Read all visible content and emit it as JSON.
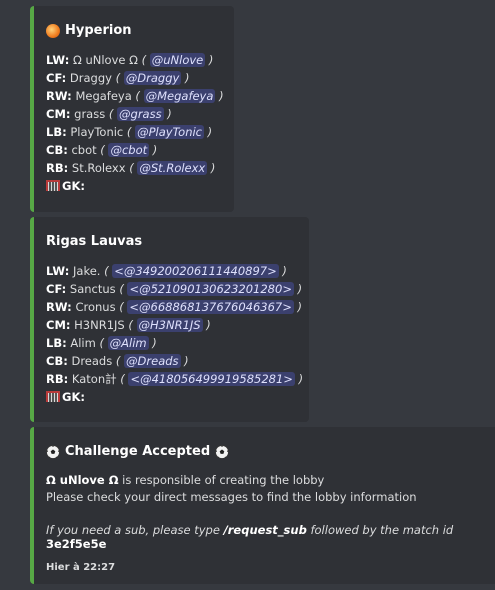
{
  "embed1": {
    "title": "Hyperion",
    "rows": [
      {
        "pos": "LW:",
        "name": "Ω uNlove Ω",
        "mention": "@uNlove"
      },
      {
        "pos": "CF:",
        "name": "Draggy",
        "mention": "@Draggy"
      },
      {
        "pos": "RW:",
        "name": "Megafeya",
        "mention": "@Megafeya"
      },
      {
        "pos": "CM:",
        "name": "grass",
        "mention": "@grass"
      },
      {
        "pos": "LB:",
        "name": "PlayTonic",
        "mention": "@PlayTonic"
      },
      {
        "pos": "CB:",
        "name": "cbot",
        "mention": "@cbot"
      },
      {
        "pos": "RB:",
        "name": "St.Rolexx",
        "mention": "@St.Rolexx"
      }
    ],
    "gk": "GK:",
    "accent": "#57a845"
  },
  "embed2": {
    "title": "Rigas Lauvas",
    "rows": [
      {
        "pos": "LW:",
        "name": "Jake.",
        "mention": "<@349200206111440897>"
      },
      {
        "pos": "CF:",
        "name": "Sanctus",
        "mention": "<@521090130623201280>"
      },
      {
        "pos": "RW:",
        "name": "Cronus",
        "mention": "<@668868137676046367>"
      },
      {
        "pos": "CM:",
        "name": "H3NR1JS",
        "mention": "@H3NR1JS"
      },
      {
        "pos": "LB:",
        "name": "Alim",
        "mention": "@Alim"
      },
      {
        "pos": "CB:",
        "name": "Dreads",
        "mention": "@Dreads"
      },
      {
        "pos": "RB:",
        "name": "Katon計",
        "mention": "<@418056499919585281>"
      }
    ],
    "gk": "GK:"
  },
  "embed3": {
    "title": "Challenge Accepted",
    "creator": "Ω uNlove Ω",
    "line1_rest": " is responsible of creating the lobby",
    "line2": "Please check your direct messages to find the lobby information",
    "note_prefix": "If you need a sub, please type ",
    "note_command": "/request_sub",
    "note_mid": " followed by the match id ",
    "note_id": "3e2f5e5e",
    "footer": "Hier à 22:27"
  },
  "icons": {
    "flame": "flame-icon",
    "goal": "goal-net-icon",
    "ball": "soccer-ball-icon"
  }
}
